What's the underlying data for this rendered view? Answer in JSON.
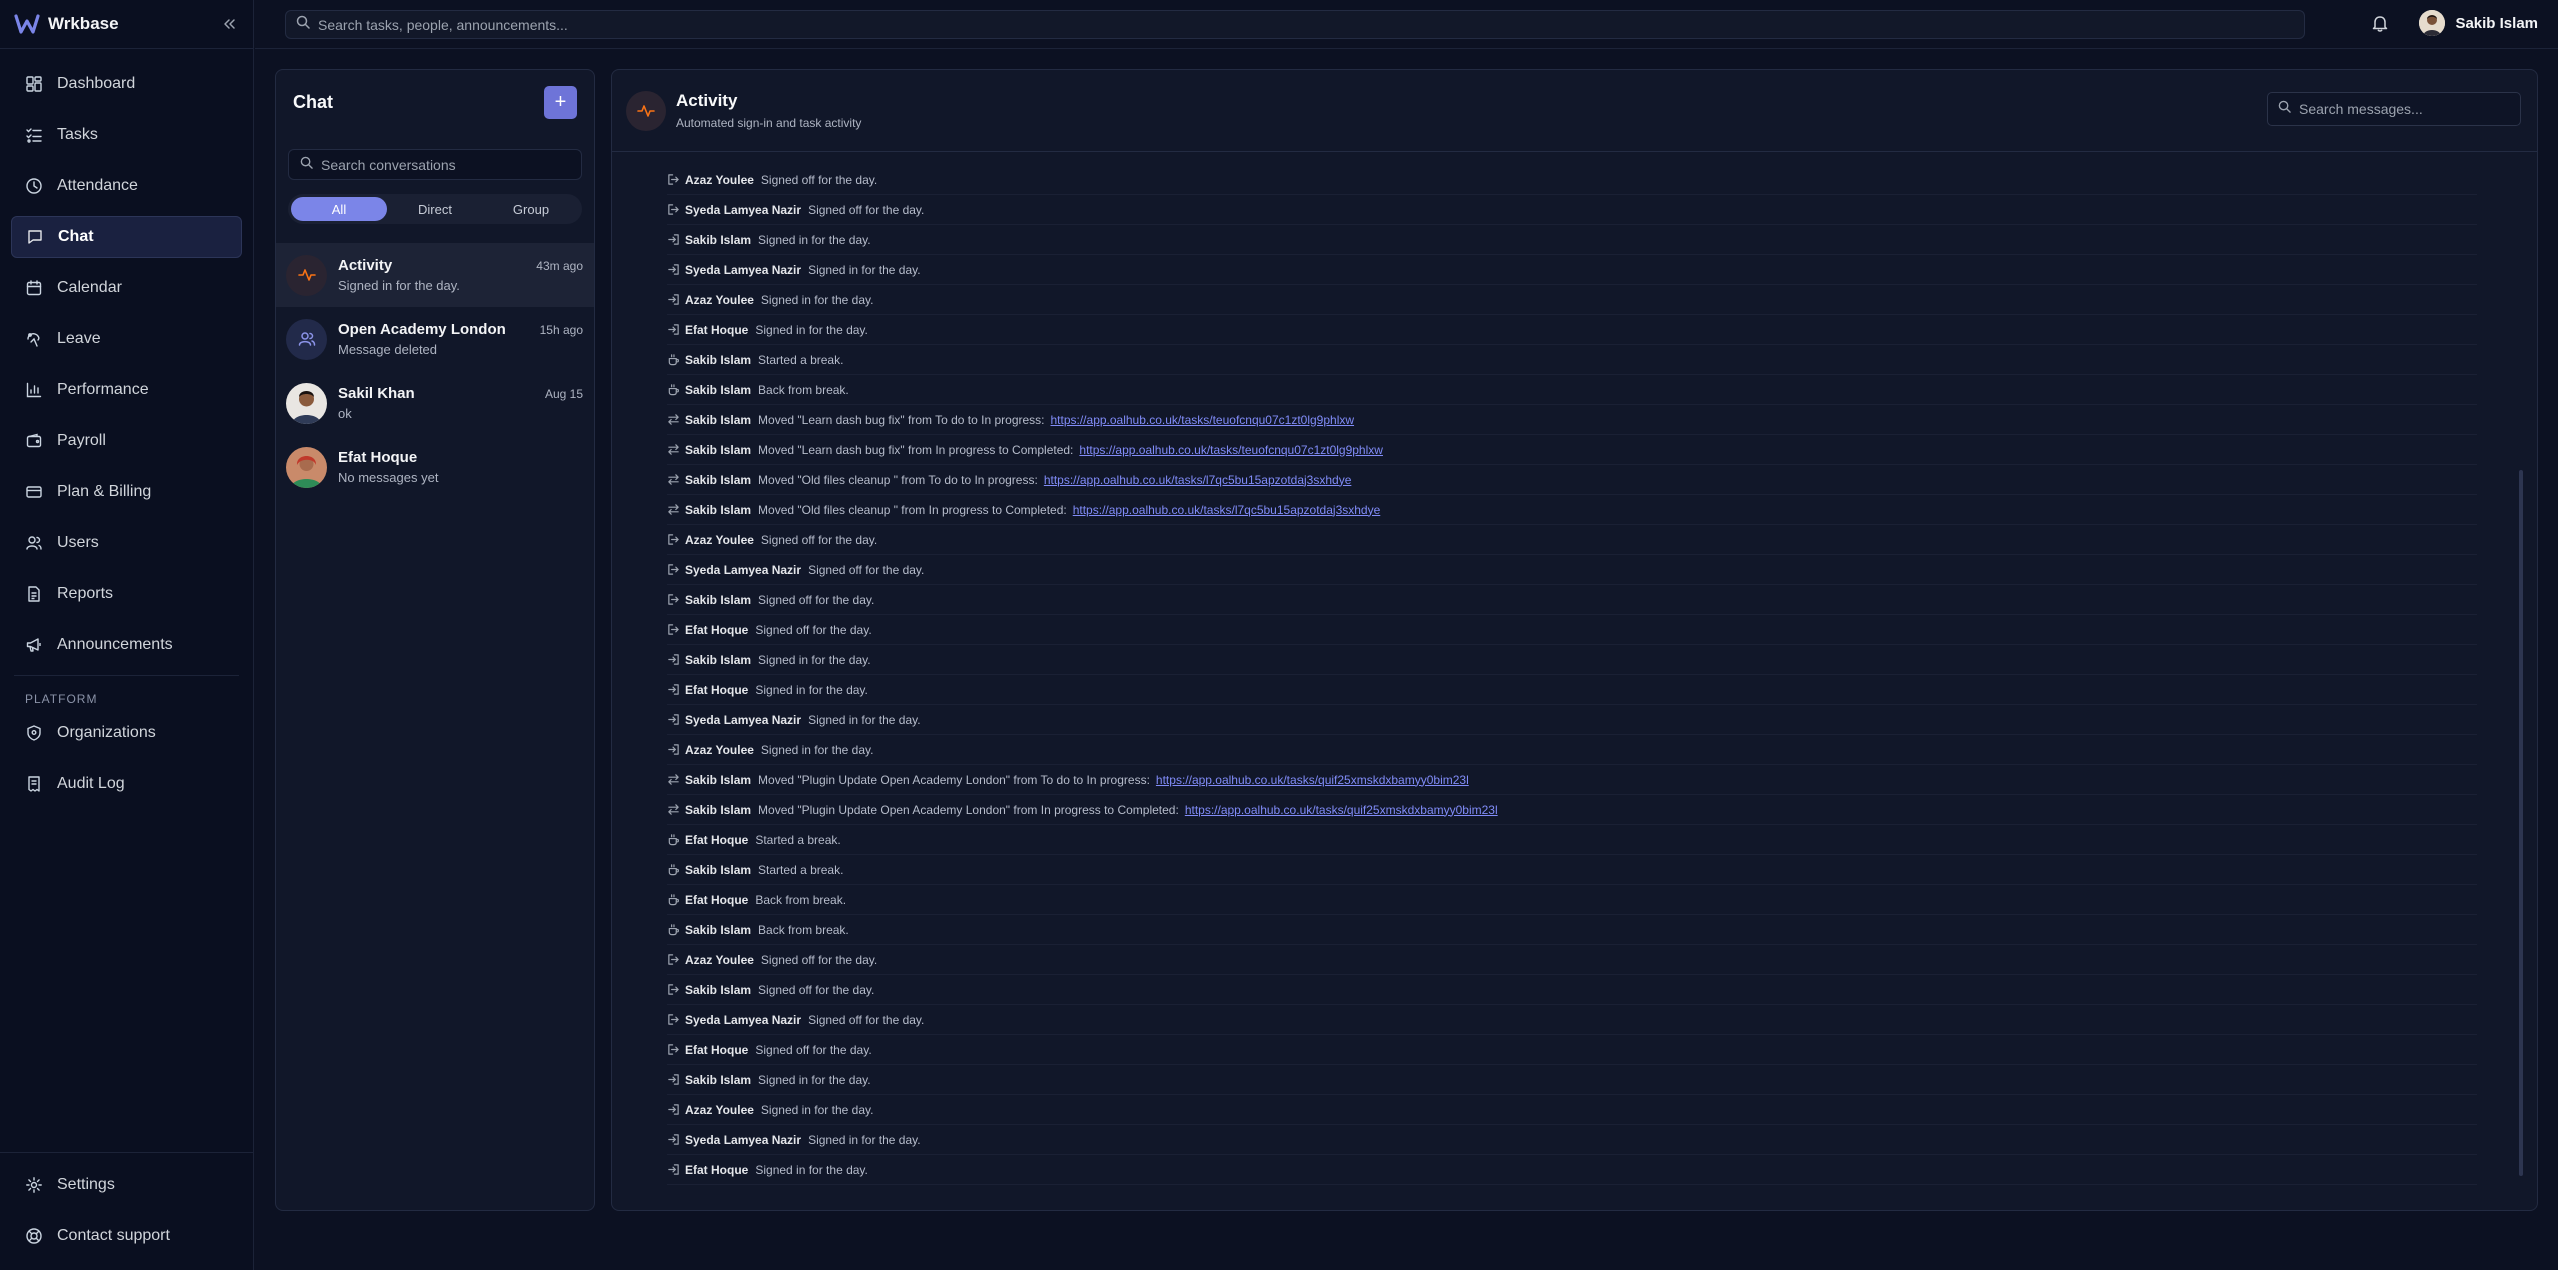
{
  "app": {
    "name": "Wrkbase",
    "search_placeholder": "Search tasks, people, announcements..."
  },
  "user": {
    "name": "Sakib Islam"
  },
  "nav": {
    "items": [
      {
        "key": "dashboard",
        "label": "Dashboard",
        "icon": "dashboard-icon"
      },
      {
        "key": "tasks",
        "label": "Tasks",
        "icon": "tasks-icon"
      },
      {
        "key": "attendance",
        "label": "Attendance",
        "icon": "clock-icon"
      },
      {
        "key": "chat",
        "label": "Chat",
        "icon": "chat-icon",
        "active": true
      },
      {
        "key": "calendar",
        "label": "Calendar",
        "icon": "calendar-icon"
      },
      {
        "key": "leave",
        "label": "Leave",
        "icon": "leave-icon"
      },
      {
        "key": "performance",
        "label": "Performance",
        "icon": "bar-chart-icon"
      },
      {
        "key": "payroll",
        "label": "Payroll",
        "icon": "wallet-icon"
      },
      {
        "key": "plan-billing",
        "label": "Plan & Billing",
        "icon": "credit-card-icon"
      },
      {
        "key": "users",
        "label": "Users",
        "icon": "users-icon"
      },
      {
        "key": "reports",
        "label": "Reports",
        "icon": "file-icon"
      },
      {
        "key": "announcements",
        "label": "Announcements",
        "icon": "megaphone-icon"
      }
    ],
    "platform_label": "PLATFORM",
    "platform_items": [
      {
        "key": "organizations",
        "label": "Organizations",
        "icon": "shield-icon"
      },
      {
        "key": "audit-log",
        "label": "Audit Log",
        "icon": "receipt-icon"
      }
    ],
    "bottom_items": [
      {
        "key": "settings",
        "label": "Settings",
        "icon": "gear-icon"
      },
      {
        "key": "contact-support",
        "label": "Contact support",
        "icon": "support-icon"
      }
    ]
  },
  "chat": {
    "title": "Chat",
    "new_button": "+",
    "search_placeholder": "Search conversations",
    "filters": [
      "All",
      "Direct",
      "Group"
    ],
    "active_filter": "All",
    "conversations": [
      {
        "name": "Activity",
        "preview": "Signed in for the day.",
        "time": "43m ago",
        "avatar": "activity-icon"
      },
      {
        "name": "Open Academy London",
        "preview": "Message deleted",
        "time": "15h ago",
        "avatar": "group-icon"
      },
      {
        "name": "Sakil Khan",
        "preview": "ok",
        "time": "Aug 15",
        "avatar": "photo"
      },
      {
        "name": "Efat Hoque",
        "preview": "No messages yet",
        "time": "",
        "avatar": "photo"
      }
    ]
  },
  "activity": {
    "title": "Activity",
    "subtitle": "Automated sign-in and task activity",
    "search_placeholder": "Search messages...",
    "entries": [
      {
        "icon": "sign-out-icon",
        "user": "Azaz Youlee",
        "text": "Signed off for the day."
      },
      {
        "icon": "sign-out-icon",
        "user": "Syeda Lamyea Nazir",
        "text": "Signed off for the day."
      },
      {
        "icon": "sign-in-icon",
        "user": "Sakib Islam",
        "text": "Signed in for the day."
      },
      {
        "icon": "sign-in-icon",
        "user": "Syeda Lamyea Nazir",
        "text": "Signed in for the day."
      },
      {
        "icon": "sign-in-icon",
        "user": "Azaz Youlee",
        "text": "Signed in for the day."
      },
      {
        "icon": "sign-in-icon",
        "user": "Efat Hoque",
        "text": "Signed in for the day."
      },
      {
        "icon": "coffee-icon",
        "user": "Sakib Islam",
        "text": "Started a break."
      },
      {
        "icon": "coffee-icon",
        "user": "Sakib Islam",
        "text": "Back from break."
      },
      {
        "icon": "move-icon",
        "user": "Sakib Islam",
        "text": "Moved \"Learn dash bug fix\" from To do to In progress:",
        "link": "https://app.oalhub.co.uk/tasks/teuofcnqu07c1zt0lg9phlxw"
      },
      {
        "icon": "move-icon",
        "user": "Sakib Islam",
        "text": "Moved \"Learn dash bug fix\" from In progress to Completed:",
        "link": "https://app.oalhub.co.uk/tasks/teuofcnqu07c1zt0lg9phlxw"
      },
      {
        "icon": "move-icon",
        "user": "Sakib Islam",
        "text": "Moved \"Old files cleanup \" from To do to In progress:",
        "link": "https://app.oalhub.co.uk/tasks/l7qc5bu15apzotdaj3sxhdye"
      },
      {
        "icon": "move-icon",
        "user": "Sakib Islam",
        "text": "Moved \"Old files cleanup \" from In progress to Completed:",
        "link": "https://app.oalhub.co.uk/tasks/l7qc5bu15apzotdaj3sxhdye"
      },
      {
        "icon": "sign-out-icon",
        "user": "Azaz Youlee",
        "text": "Signed off for the day."
      },
      {
        "icon": "sign-out-icon",
        "user": "Syeda Lamyea Nazir",
        "text": "Signed off for the day."
      },
      {
        "icon": "sign-out-icon",
        "user": "Sakib Islam",
        "text": "Signed off for the day."
      },
      {
        "icon": "sign-out-icon",
        "user": "Efat Hoque",
        "text": "Signed off for the day."
      },
      {
        "icon": "sign-in-icon",
        "user": "Sakib Islam",
        "text": "Signed in for the day."
      },
      {
        "icon": "sign-in-icon",
        "user": "Efat Hoque",
        "text": "Signed in for the day."
      },
      {
        "icon": "sign-in-icon",
        "user": "Syeda Lamyea Nazir",
        "text": "Signed in for the day."
      },
      {
        "icon": "sign-in-icon",
        "user": "Azaz Youlee",
        "text": "Signed in for the day."
      },
      {
        "icon": "move-icon",
        "user": "Sakib Islam",
        "text": "Moved \"Plugin Update Open Academy London\" from To do to In progress:",
        "link": "https://app.oalhub.co.uk/tasks/quif25xmskdxbamyy0bim23l"
      },
      {
        "icon": "move-icon",
        "user": "Sakib Islam",
        "text": "Moved \"Plugin Update Open Academy London\" from In progress to Completed:",
        "link": "https://app.oalhub.co.uk/tasks/quif25xmskdxbamyy0bim23l"
      },
      {
        "icon": "coffee-icon",
        "user": "Efat Hoque",
        "text": "Started a break."
      },
      {
        "icon": "coffee-icon",
        "user": "Sakib Islam",
        "text": "Started a break."
      },
      {
        "icon": "coffee-icon",
        "user": "Efat Hoque",
        "text": "Back from break."
      },
      {
        "icon": "coffee-icon",
        "user": "Sakib Islam",
        "text": "Back from break."
      },
      {
        "icon": "sign-out-icon",
        "user": "Azaz Youlee",
        "text": "Signed off for the day."
      },
      {
        "icon": "sign-out-icon",
        "user": "Sakib Islam",
        "text": "Signed off for the day."
      },
      {
        "icon": "sign-out-icon",
        "user": "Syeda Lamyea Nazir",
        "text": "Signed off for the day."
      },
      {
        "icon": "sign-out-icon",
        "user": "Efat Hoque",
        "text": "Signed off for the day."
      },
      {
        "icon": "sign-in-icon",
        "user": "Sakib Islam",
        "text": "Signed in for the day."
      },
      {
        "icon": "sign-in-icon",
        "user": "Azaz Youlee",
        "text": "Signed in for the day."
      },
      {
        "icon": "sign-in-icon",
        "user": "Syeda Lamyea Nazir",
        "text": "Signed in for the day."
      },
      {
        "icon": "sign-in-icon",
        "user": "Efat Hoque",
        "text": "Signed in for the day."
      }
    ]
  },
  "colors": {
    "accent": "#6e74d8",
    "link": "#818cf8",
    "activity_icon": "#f97316"
  }
}
